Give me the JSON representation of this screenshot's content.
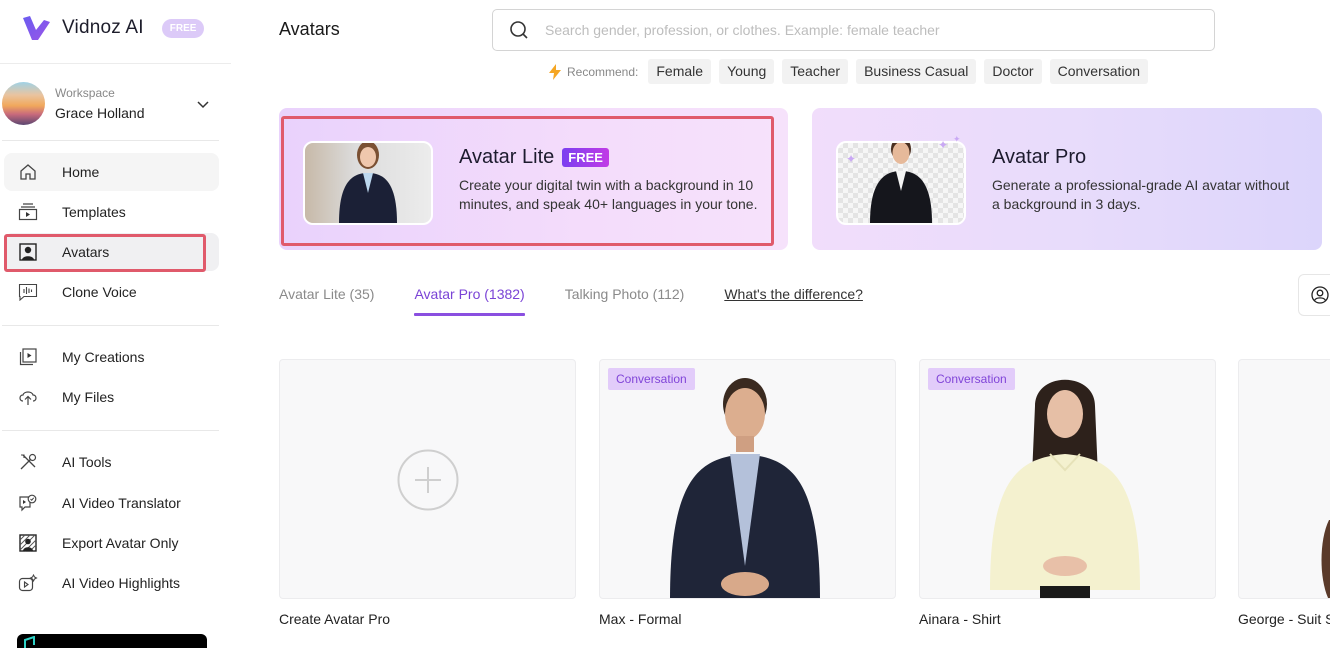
{
  "brand": {
    "name": "Vidnoz AI",
    "plan_badge": "FREE"
  },
  "workspace": {
    "label": "Workspace",
    "user_name": "Grace Holland"
  },
  "sidebar": {
    "items": [
      {
        "label": "Home",
        "icon": "home-icon"
      },
      {
        "label": "Templates",
        "icon": "templates-icon"
      },
      {
        "label": "Avatars",
        "icon": "avatar-icon",
        "active": true
      },
      {
        "label": "Clone Voice",
        "icon": "voice-icon"
      },
      {
        "label": "My Creations",
        "icon": "creations-icon"
      },
      {
        "label": "My Files",
        "icon": "upload-cloud-icon"
      },
      {
        "label": "AI Tools",
        "icon": "tools-icon"
      },
      {
        "label": "AI Video Translator",
        "icon": "translator-icon"
      },
      {
        "label": "Export Avatar Only",
        "icon": "export-avatar-icon"
      },
      {
        "label": "AI Video Highlights",
        "icon": "highlights-icon"
      }
    ]
  },
  "header": {
    "title": "Avatars",
    "search": {
      "placeholder": "Search gender, profession, or clothes. Example: female teacher",
      "value": ""
    },
    "recommend_label": "Recommend:",
    "recommend_tags": [
      "Female",
      "Young",
      "Teacher",
      "Business Casual",
      "Doctor",
      "Conversation"
    ]
  },
  "feature_cards": [
    {
      "title": "Avatar Lite",
      "badge": "FREE",
      "description": "Create your digital twin with a background in 10 minutes, and speak 40+ languages in your tone."
    },
    {
      "title": "Avatar Pro",
      "description": "Generate a professional-grade AI avatar without a background in 3 days."
    }
  ],
  "tabs": [
    {
      "label": "Avatar Lite (35)"
    },
    {
      "label": "Avatar Pro (1382)",
      "active": true
    },
    {
      "label": "Talking Photo (112)"
    }
  ],
  "difference_link": "What's the difference?",
  "avatars": [
    {
      "name": "Create Avatar Pro"
    },
    {
      "name": "Max - Formal",
      "tag": "Conversation"
    },
    {
      "name": "Ainara - Shirt",
      "tag": "Conversation"
    },
    {
      "name": "George - Suit S"
    }
  ],
  "colors": {
    "accent": "#8a4fe0",
    "highlight": "#e05a6b",
    "tag_bg": "#e2ccfa"
  }
}
